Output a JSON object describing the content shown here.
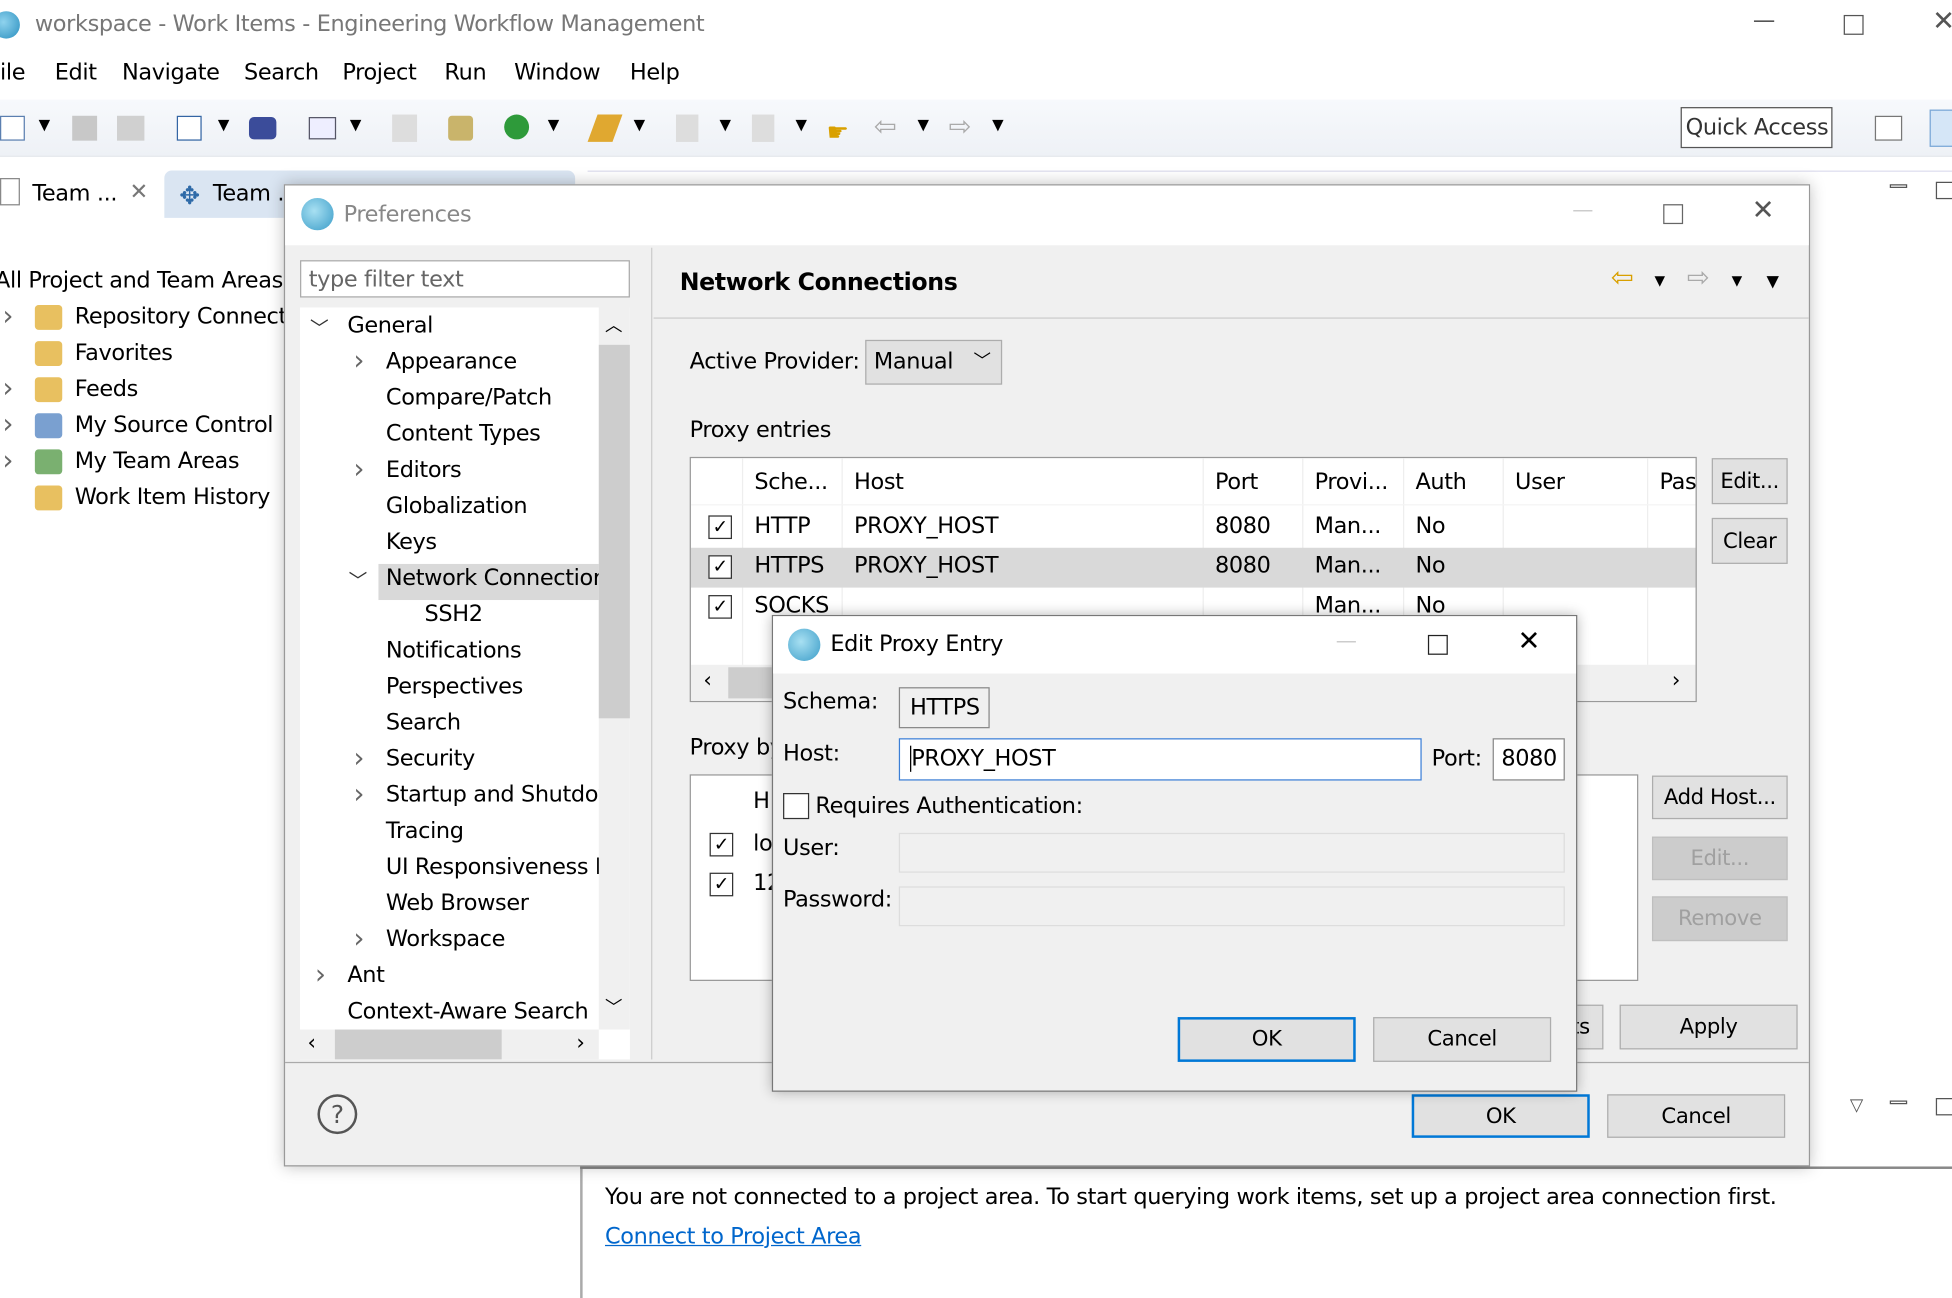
{
  "window": {
    "title": "workspace - Work Items - Engineering Workflow Management"
  },
  "menu": [
    "ile",
    "Edit",
    "Navigate",
    "Search",
    "Project",
    "Run",
    "Window",
    "Help"
  ],
  "toolbar": {
    "quick_access": "Quick Access"
  },
  "tabs": [
    {
      "label": "Team ...",
      "active": true
    },
    {
      "label": "Team ..."
    }
  ],
  "team_tree": {
    "root": "All Project and Team Areas (",
    "items": [
      "Repository Connect",
      "Favorites",
      "Feeds",
      "My Source Control",
      "My Team Areas",
      "Work Item History"
    ]
  },
  "bottom_view": {
    "message": "You are not connected to a project area. To start querying work items, set up a project area connection first.",
    "link": "Connect to Project Area"
  },
  "preferences": {
    "title": "Preferences",
    "filter_placeholder": "type filter text",
    "tree": [
      {
        "label": "General",
        "level": 0,
        "expanded": true
      },
      {
        "label": "Appearance",
        "level": 1,
        "children": true
      },
      {
        "label": "Compare/Patch",
        "level": 1
      },
      {
        "label": "Content Types",
        "level": 1
      },
      {
        "label": "Editors",
        "level": 1,
        "children": true
      },
      {
        "label": "Globalization",
        "level": 1
      },
      {
        "label": "Keys",
        "level": 1
      },
      {
        "label": "Network Connectior",
        "level": 1,
        "expanded": true,
        "selected": true
      },
      {
        "label": "SSH2",
        "level": 2
      },
      {
        "label": "Notifications",
        "level": 1
      },
      {
        "label": "Perspectives",
        "level": 1
      },
      {
        "label": "Search",
        "level": 1
      },
      {
        "label": "Security",
        "level": 1,
        "children": true
      },
      {
        "label": "Startup and Shutdov",
        "level": 1,
        "children": true
      },
      {
        "label": "Tracing",
        "level": 1
      },
      {
        "label": "UI Responsiveness M",
        "level": 1
      },
      {
        "label": "Web Browser",
        "level": 1
      },
      {
        "label": "Workspace",
        "level": 1,
        "children": true
      },
      {
        "label": "Ant",
        "level": 0,
        "children": true
      },
      {
        "label": "Context-Aware Search",
        "level": 0
      }
    ],
    "page_title": "Network Connections",
    "active_provider_label": "Active Provider:",
    "active_provider_value": "Manual",
    "proxy_entries_label": "Proxy entries",
    "proxy_columns": [
      "Sche...",
      "Host",
      "Port",
      "Provi...",
      "Auth",
      "User",
      "Pas"
    ],
    "proxy_rows": [
      {
        "checked": true,
        "cells": [
          "HTTP",
          "PROXY_HOST",
          "8080",
          "Man...",
          "No",
          "",
          ""
        ]
      },
      {
        "checked": true,
        "selected": true,
        "cells": [
          "HTTPS",
          "PROXY_HOST",
          "8080",
          "Man...",
          "No",
          "",
          ""
        ]
      },
      {
        "checked": true,
        "cells": [
          "SOCKS",
          "",
          "",
          "Man...",
          "No",
          "",
          ""
        ]
      }
    ],
    "edit_button": "Edit...",
    "clear_button": "Clear",
    "proxy_bypass_label": "Proxy by",
    "bypass_header": "H",
    "bypass_rows": [
      {
        "checked": true,
        "text": "lo"
      },
      {
        "checked": true,
        "text": "12"
      }
    ],
    "add_host_button": "Add Host...",
    "bypass_edit_button": "Edit...",
    "remove_button": "Remove",
    "restore_defaults_partial": "ts",
    "apply_button": "Apply",
    "ok_button": "OK",
    "cancel_button": "Cancel"
  },
  "edit_proxy": {
    "title": "Edit Proxy Entry",
    "schema_label": "Schema:",
    "schema_value": "HTTPS",
    "host_label": "Host:",
    "host_value": "PROXY_HOST",
    "port_label": "Port:",
    "port_value": "8080",
    "requires_auth_label": "Requires Authentication:",
    "requires_auth": false,
    "user_label": "User:",
    "user_value": "",
    "password_label": "Password:",
    "password_value": "",
    "ok_button": "OK",
    "cancel_button": "Cancel"
  },
  "colors": {
    "accent": "#0078d7",
    "link": "#0066cc",
    "selection": "#d9d9d9",
    "dialog_bg": "#f0f0f0"
  }
}
